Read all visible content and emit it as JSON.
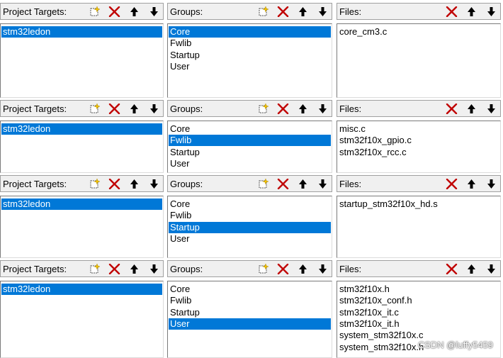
{
  "sections": [
    {
      "targets": {
        "label": "Project Targets:",
        "items": [
          "stm32ledon"
        ],
        "selected": 0
      },
      "groups": {
        "label": "Groups:",
        "items": [
          "Core",
          "Fwlib",
          "Startup",
          "User"
        ],
        "selected": 0
      },
      "files": {
        "label": "Files:",
        "items": [
          "core_cm3.c"
        ]
      }
    },
    {
      "targets": {
        "label": "Project Targets:",
        "items": [
          "stm32ledon"
        ],
        "selected": 0
      },
      "groups": {
        "label": "Groups:",
        "items": [
          "Core",
          "Fwlib",
          "Startup",
          "User"
        ],
        "selected": 1
      },
      "files": {
        "label": "Files:",
        "items": [
          "misc.c",
          "stm32f10x_gpio.c",
          "stm32f10x_rcc.c"
        ]
      }
    },
    {
      "targets": {
        "label": "Project Targets:",
        "items": [
          "stm32ledon"
        ],
        "selected": 0
      },
      "groups": {
        "label": "Groups:",
        "items": [
          "Core",
          "Fwlib",
          "Startup",
          "User"
        ],
        "selected": 2
      },
      "files": {
        "label": "Files:",
        "items": [
          "startup_stm32f10x_hd.s"
        ]
      }
    },
    {
      "targets": {
        "label": "Project Targets:",
        "items": [
          "stm32ledon"
        ],
        "selected": 0
      },
      "groups": {
        "label": "Groups:",
        "items": [
          "Core",
          "Fwlib",
          "Startup",
          "User"
        ],
        "selected": 3
      },
      "files": {
        "label": "Files:",
        "items": [
          "stm32f10x.h",
          "stm32f10x_conf.h",
          "stm32f10x_it.c",
          "stm32f10x_it.h",
          "system_stm32f10x.c",
          "system_stm32f10x.h"
        ]
      }
    }
  ],
  "toolbar_icons": {
    "new": "new-item-icon",
    "delete": "delete-icon",
    "move_up": "arrow-up-icon",
    "move_down": "arrow-down-icon"
  },
  "colors": {
    "selection": "#0078d7",
    "delete_icon": "#c00000"
  },
  "watermark": "CSDN @luffy5459"
}
